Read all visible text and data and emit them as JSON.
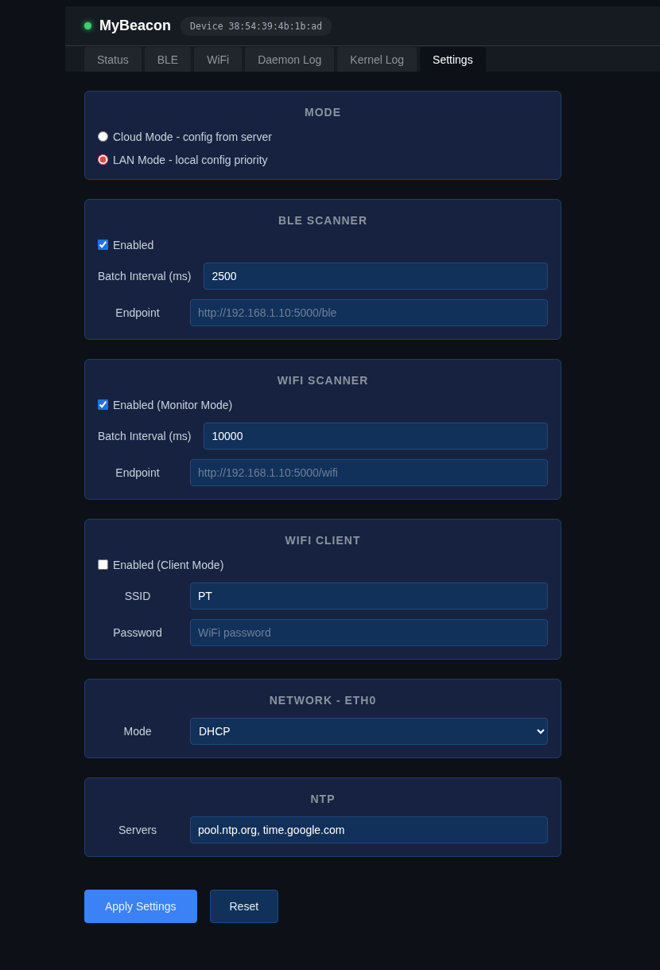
{
  "app": {
    "title": "MyBeacon",
    "online": true,
    "device": "Device 38:54:39:4b:1b:ad"
  },
  "tabs": [
    {
      "label": "Status",
      "selected": false
    },
    {
      "label": "BLE",
      "selected": false
    },
    {
      "label": "WiFi",
      "selected": false
    },
    {
      "label": "Daemon Log",
      "selected": false
    },
    {
      "label": "Kernel Log",
      "selected": false
    },
    {
      "label": "Settings",
      "selected": true
    }
  ],
  "sections": [
    {
      "title": "MODE",
      "fields": [
        {
          "kind": "radio",
          "label": "Cloud Mode - config from server",
          "selected": false
        },
        {
          "kind": "radio",
          "label": "LAN Mode - local config priority",
          "selected": true
        }
      ]
    },
    {
      "title": "BLE SCANNER",
      "fields": [
        {
          "kind": "checkbox",
          "label": "Enabled",
          "checked": true
        },
        {
          "kind": "text",
          "label": "Batch Interval (ms)",
          "value": "2500"
        },
        {
          "kind": "text",
          "label": "Endpoint",
          "placeholder": "http://192.168.1.10:5000/ble"
        }
      ]
    },
    {
      "title": "WIFI SCANNER",
      "fields": [
        {
          "kind": "checkbox",
          "label": "Enabled (Monitor Mode)",
          "checked": true
        },
        {
          "kind": "text",
          "label": "Batch Interval (ms)",
          "value": "10000"
        },
        {
          "kind": "text",
          "label": "Endpoint",
          "placeholder": "http://192.168.1.10:5000/wifi"
        }
      ]
    },
    {
      "title": "WIFI CLIENT",
      "fields": [
        {
          "kind": "checkbox",
          "label": "Enabled (Client Mode)",
          "checked": false
        },
        {
          "kind": "text",
          "label": "SSID",
          "value": "PT"
        },
        {
          "kind": "text",
          "label": "Password",
          "placeholder": "WiFi password"
        }
      ]
    },
    {
      "title": "NETWORK - ETH0",
      "fields": [
        {
          "kind": "select",
          "label": "Mode",
          "value": "DHCP"
        }
      ]
    },
    {
      "title": "NTP",
      "fields": [
        {
          "kind": "text",
          "label": "Servers",
          "value": "pool.ntp.org, time.google.com"
        }
      ]
    }
  ],
  "buttons": [
    {
      "label": "Apply Settings",
      "kind": "primary"
    },
    {
      "label": "Reset",
      "kind": "secondary"
    }
  ]
}
